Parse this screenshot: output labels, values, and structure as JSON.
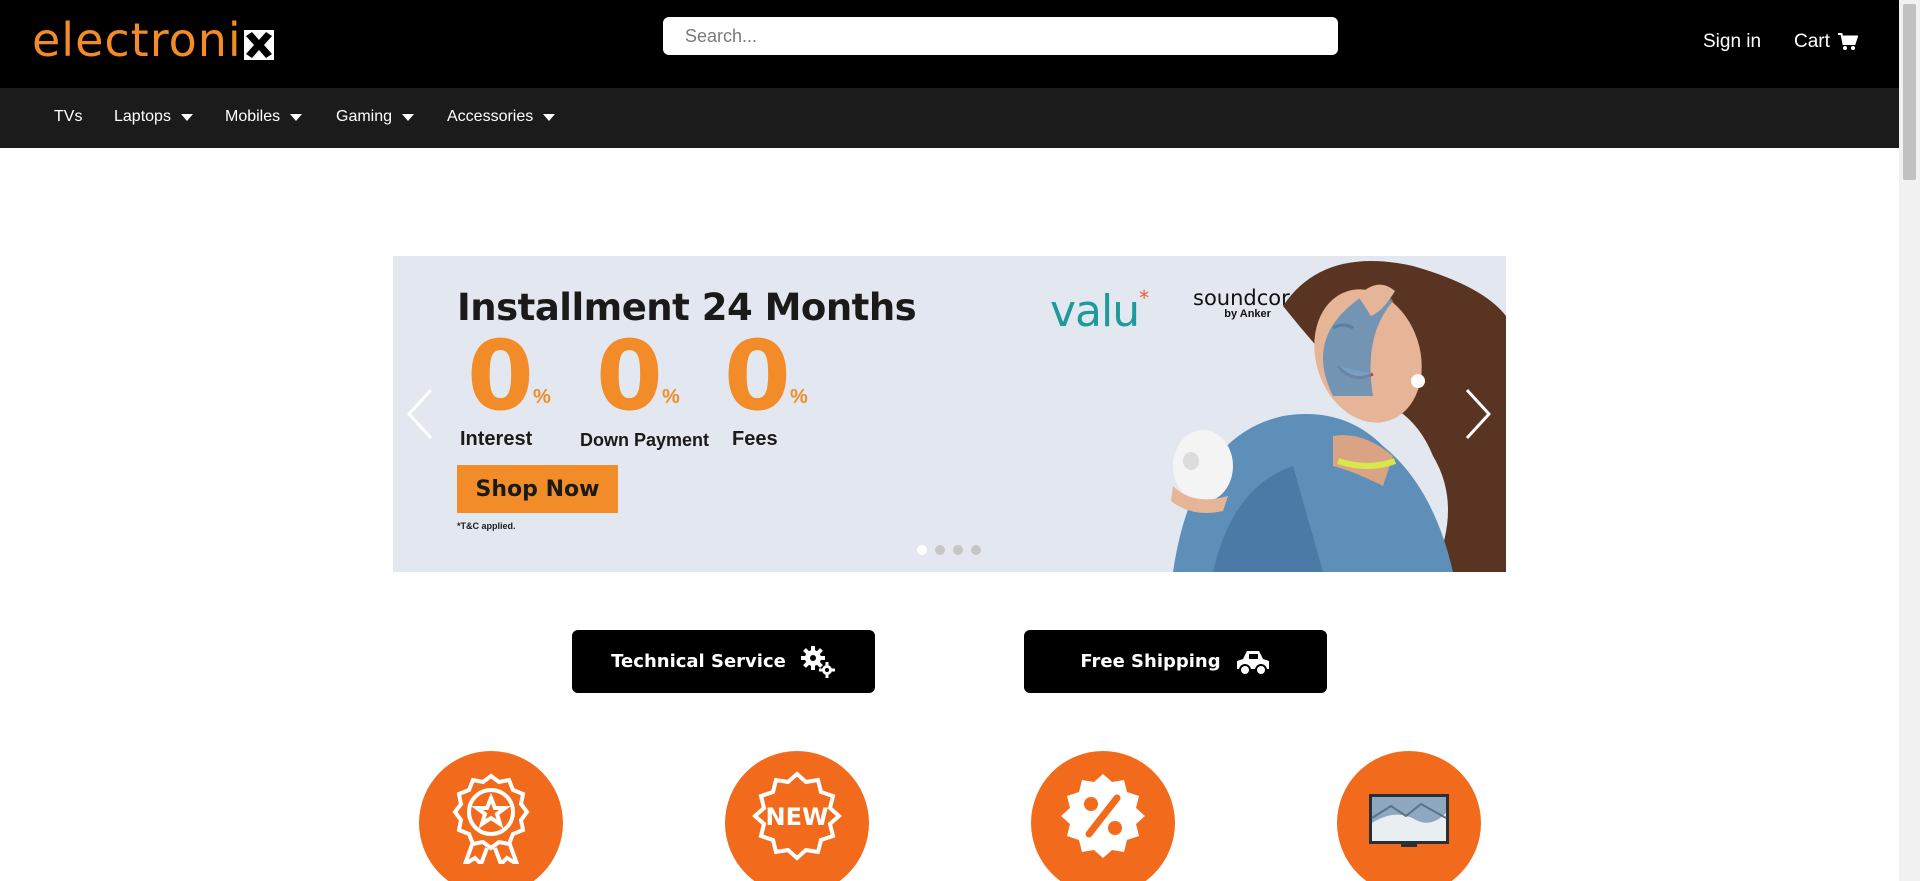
{
  "brand": {
    "logo_text": "electroni",
    "accent": "#f28c28"
  },
  "header": {
    "search_placeholder": "Search...",
    "sign_in": "Sign in",
    "cart": "Cart"
  },
  "nav": {
    "items": [
      {
        "label": "TVs",
        "dropdown": false
      },
      {
        "label": "Laptops",
        "dropdown": true
      },
      {
        "label": "Mobiles",
        "dropdown": true
      },
      {
        "label": "Gaming",
        "dropdown": true
      },
      {
        "label": "Accessories",
        "dropdown": true
      }
    ]
  },
  "banner": {
    "title": "Installment 24 Months",
    "offers": [
      {
        "value": "0",
        "unit": "%",
        "label": "Interest"
      },
      {
        "value": "0",
        "unit": "%",
        "label": "Down Payment"
      },
      {
        "value": "0",
        "unit": "%",
        "label": "Fees"
      }
    ],
    "cta": "Shop Now",
    "terms": "*T&C applied.",
    "partner_1": "valu",
    "partner_1_mark": "*",
    "partner_2": "soundcore",
    "partner_2_sub": "by Anker",
    "slide_count": 4,
    "active_slide": 1
  },
  "services": {
    "technical": "Technical Service",
    "shipping": "Free Shipping",
    "technical_icon": "gears-icon",
    "shipping_icon": "truck-icon"
  },
  "categories": [
    {
      "icon": "award-badge-icon"
    },
    {
      "icon": "new-badge-icon"
    },
    {
      "icon": "discount-badge-icon"
    },
    {
      "icon": "tv-icon"
    }
  ],
  "colors": {
    "header_bg": "#000000",
    "nav_bg": "#1b1b1b",
    "circle_bg": "#f26b1d",
    "banner_bg": "#e3e7ef"
  }
}
